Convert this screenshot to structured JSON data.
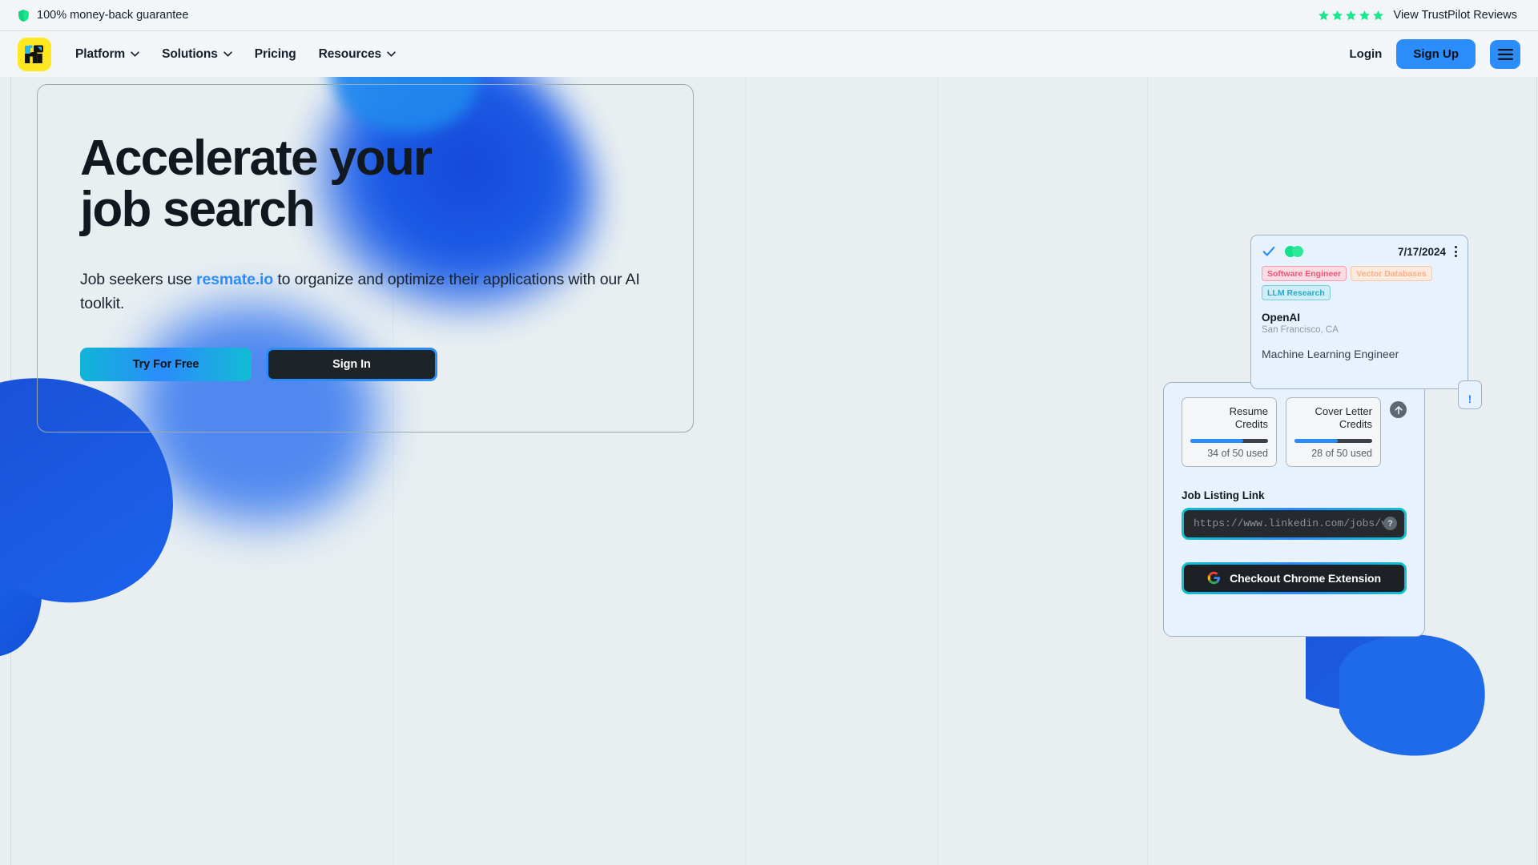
{
  "announcement": {
    "guarantee_text": "100% money-back guarantee",
    "shield_icon": "shield-icon",
    "star_icon": "star-icon",
    "star_count": 5,
    "star_color": "#1ae68c",
    "trustpilot_link": "View TrustPilot Reviews"
  },
  "nav": {
    "logo_icon": "resmate-logo-icon",
    "logo_bg": "#ffe81f",
    "items": [
      {
        "label": "Platform",
        "has_dropdown": true
      },
      {
        "label": "Solutions",
        "has_dropdown": true
      },
      {
        "label": "Pricing",
        "has_dropdown": false
      },
      {
        "label": "Resources",
        "has_dropdown": true
      }
    ],
    "login_label": "Login",
    "signup_label": "Sign Up",
    "menu_icon": "hamburger-menu-icon",
    "accent": "#2b8cfb"
  },
  "hero": {
    "heading_line1": "Accelerate your",
    "heading_line2": "job search",
    "sub_part1": "Job seekers use ",
    "sub_brand": "resmate.io",
    "sub_part2": " to organize and optimize their applications with our AI toolkit.",
    "cta_primary": "Try For Free",
    "cta_secondary": "Sign In"
  },
  "job_card": {
    "check_icon": "check-icon",
    "status_dots_icon": "status-dots-icon",
    "date": "7/17/2024",
    "kebab_icon": "kebab-menu-icon",
    "tags": [
      {
        "label": "Software Engineer",
        "color": "#f0527a",
        "bg": "#fcdbe3",
        "border": "#f59cb2"
      },
      {
        "label": "Vector Databases",
        "color": "#f9b088",
        "bg": "#fde8db",
        "border": "#fbc6a6"
      },
      {
        "label": "LLM Research",
        "color": "#2fa7c4",
        "bg": "#cdeef5",
        "border": "#7cc9dd"
      }
    ],
    "company": "OpenAI",
    "location": "San Francisco, CA",
    "role": "Machine Learning Engineer",
    "alert_badge": "!"
  },
  "credits_panel": {
    "credits": [
      {
        "title_line1": "Resume",
        "title_line2": "Credits",
        "used": 34,
        "total": 50,
        "used_label": "34 of 50 used",
        "percent": 68
      },
      {
        "title_line1": "Cover Letter",
        "title_line2": "Credits",
        "used": 28,
        "total": 50,
        "used_label": "28 of 50 used",
        "percent": 56
      }
    ],
    "upgrade_icon": "arrow-up-circle-icon",
    "job_link_label": "Job Listing Link",
    "job_link_placeholder": "https://www.linkedin.com/jobs/v",
    "job_link_value": "",
    "help_icon": "question-mark-icon",
    "chrome_button_label": "Checkout Chrome Extension",
    "chrome_icon": "google-g-icon",
    "bar_color": "#2b8cfb"
  },
  "theme": {
    "page_bg": "#e9eff1",
    "bar_bg": "#f2f6f8",
    "accent_blue": "#2b8cfb",
    "accent_cyan": "#0fc0cf",
    "dark": "#1e2328",
    "gridline": "#d3dde1"
  }
}
